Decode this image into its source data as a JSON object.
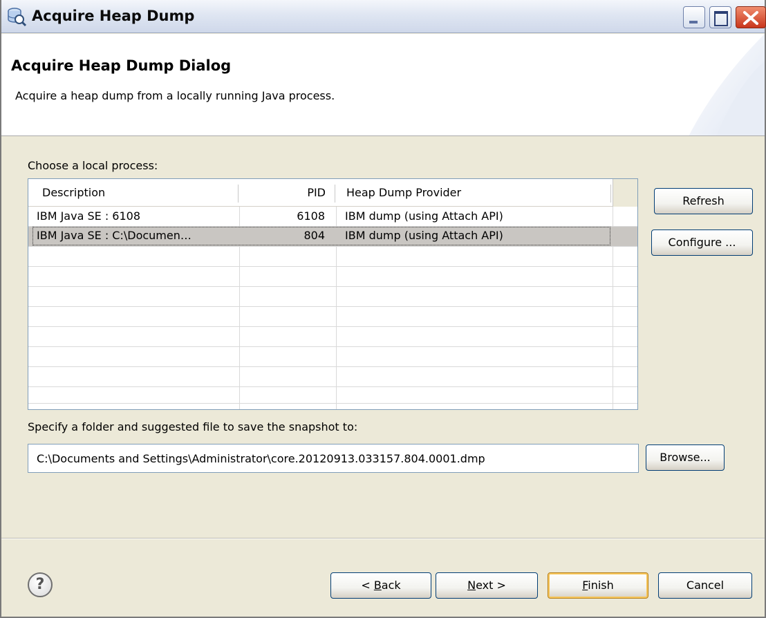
{
  "window": {
    "title": "Acquire Heap Dump",
    "controls": [
      "minimize-icon",
      "maximize-icon",
      "close-icon"
    ]
  },
  "banner": {
    "title": "Acquire Heap Dump Dialog",
    "description": "Acquire a heap dump from a locally running Java process."
  },
  "process_section": {
    "label": "Choose a local process:",
    "columns": [
      "Description",
      "PID",
      "Heap Dump Provider"
    ],
    "rows": [
      {
        "description": "IBM Java SE : 6108",
        "pid": "6108",
        "provider": "IBM dump (using Attach API)",
        "selected": false
      },
      {
        "description": "IBM Java SE : C:\\Documen…",
        "pid": "804",
        "provider": "IBM dump (using Attach API)",
        "selected": true
      }
    ],
    "buttons": {
      "refresh": "Refresh",
      "configure": "Configure ..."
    }
  },
  "snapshot_section": {
    "label": "Specify a folder and suggested file to save the snapshot to:",
    "path_value": "C:\\Documents and Settings\\Administrator\\core.20120913.033157.804.0001.dmp",
    "browse_label": "Browse..."
  },
  "footer": {
    "help_icon": "help-icon",
    "back_label_pre": "< ",
    "back_mnemonic": "B",
    "back_label_post": "ack",
    "next_mnemonic": "N",
    "next_label_post": "ext >",
    "finish_mnemonic": "F",
    "finish_label_post": "inish",
    "cancel_label": "Cancel"
  },
  "colors": {
    "dialog_bg": "#ece9d8",
    "selected_row": "#c9c6c2",
    "default_button_border": "#f7c65a",
    "close_button": "#c9361c"
  }
}
